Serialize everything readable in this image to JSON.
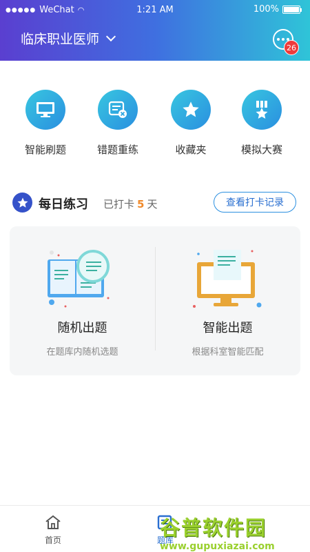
{
  "status_bar": {
    "carrier": "WeChat",
    "time": "1:21 AM",
    "battery": "100%"
  },
  "header": {
    "title": "临床职业医师",
    "message_count": "26"
  },
  "features": [
    {
      "label": "智能刷题",
      "icon": "monitor-icon"
    },
    {
      "label": "错题重练",
      "icon": "wrong-question-icon"
    },
    {
      "label": "收藏夹",
      "icon": "star-icon"
    },
    {
      "label": "模拟大赛",
      "icon": "medal-icon"
    }
  ],
  "daily": {
    "title": "每日练习",
    "checkin_prefix": "已打卡",
    "checkin_days": "5",
    "checkin_suffix": "天",
    "record_button": "查看打卡记录"
  },
  "practice_options": [
    {
      "name": "随机出题",
      "desc": "在题库内随机选题"
    },
    {
      "name": "智能出题",
      "desc": "根据科室智能匹配"
    }
  ],
  "tabbar": {
    "home": "首页",
    "question_bank": "题库"
  },
  "watermark": {
    "line1": "谷普软件园",
    "line2": "www.gupuxiazai.com"
  },
  "colors": {
    "accent": "#2a8fe0",
    "highlight": "#f08a2b",
    "badge": "#ee3b3b"
  }
}
